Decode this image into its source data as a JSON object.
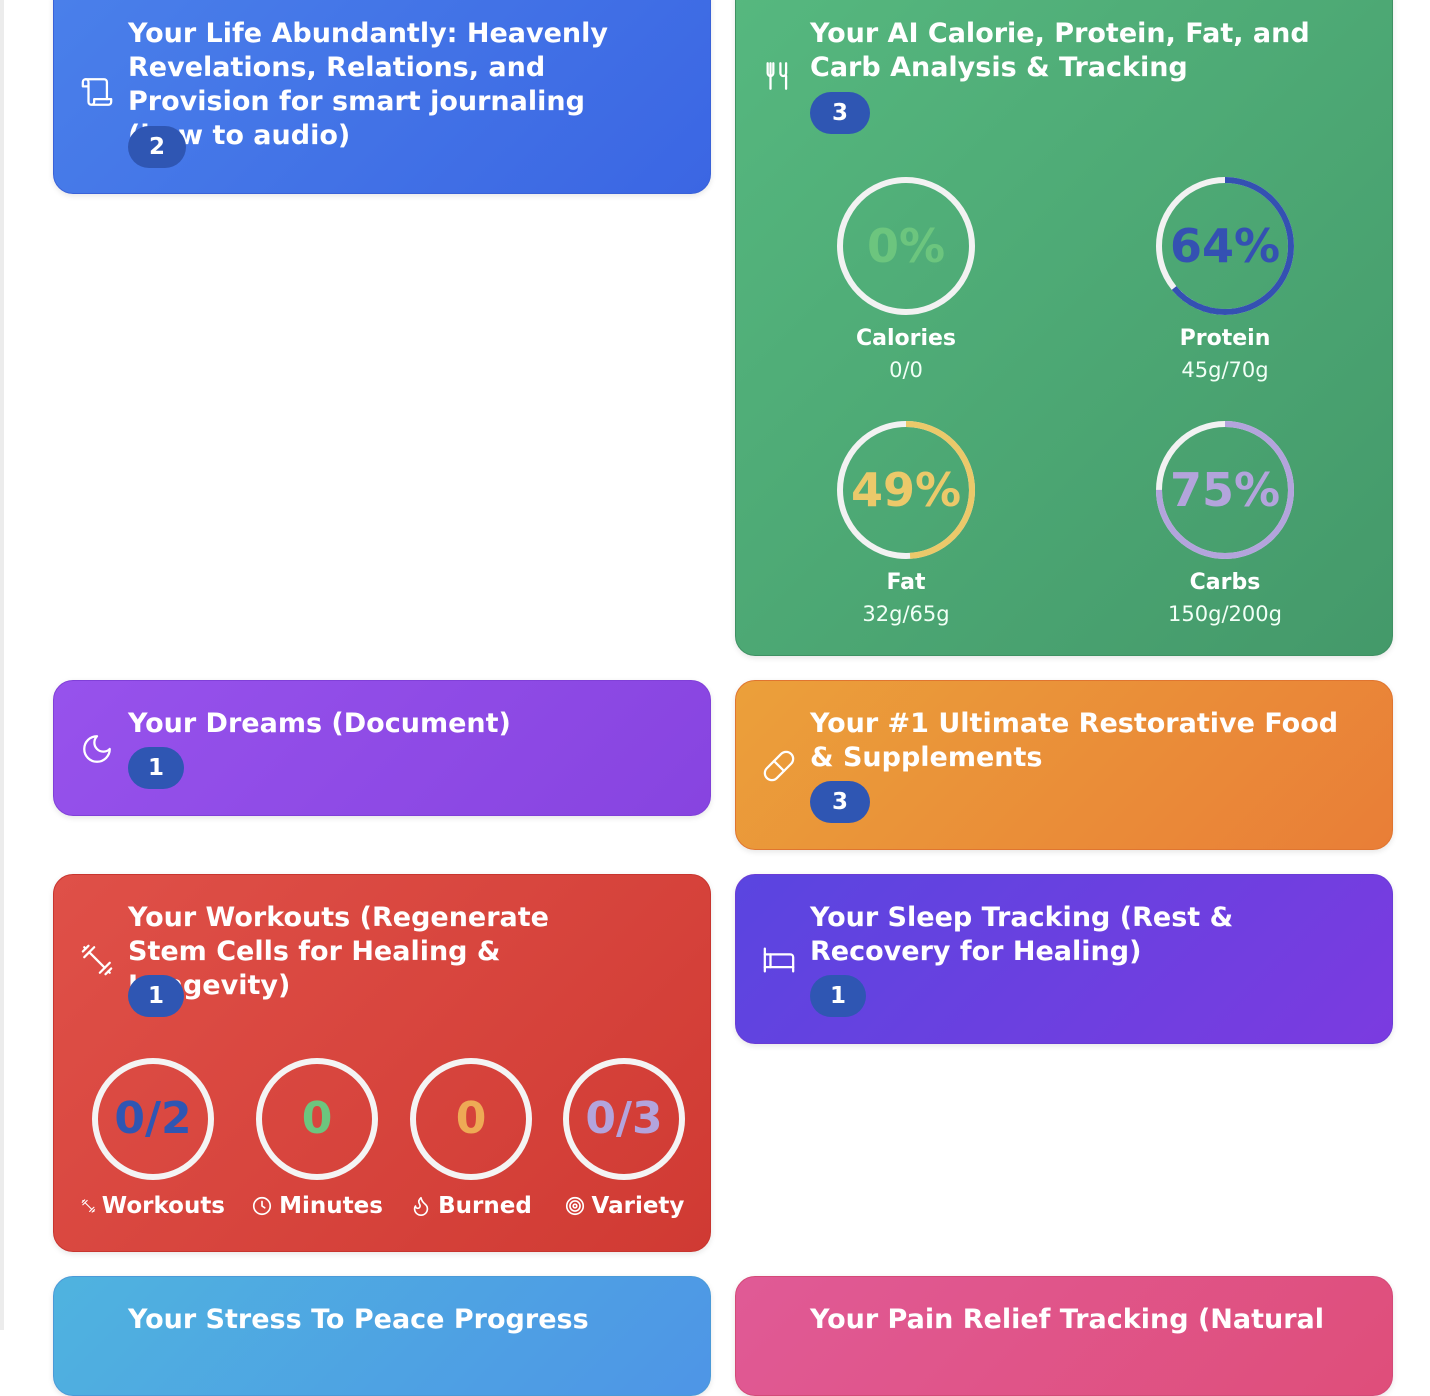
{
  "cards": {
    "journal": {
      "title": "Your Life Abundantly: Heavenly Revelations, Relations, and Provision for smart journaling (how to audio)",
      "badge": "2",
      "icon": "scroll-icon"
    },
    "nutrition": {
      "title": "Your AI Calorie, Protein, Fat, and Carb Analysis & Tracking",
      "badge": "3",
      "icon": "fork-knife-icon",
      "stats": [
        {
          "label": "Calories",
          "value": "0/0",
          "percent_text": "0%",
          "percent": 0,
          "color": "#6cc57e"
        },
        {
          "label": "Protein",
          "value": "45g/70g",
          "percent_text": "64%",
          "percent": 64,
          "color": "#3451b2"
        },
        {
          "label": "Fat",
          "value": "32g/65g",
          "percent_text": "49%",
          "percent": 49,
          "color": "#ebc96a"
        },
        {
          "label": "Carbs",
          "value": "150g/200g",
          "percent_text": "75%",
          "percent": 75,
          "color": "#b3a4dc"
        }
      ]
    },
    "dreams": {
      "title": "Your Dreams (Document)",
      "badge": "1",
      "icon": "moon-icon"
    },
    "supplements": {
      "title": "Your #1 Ultimate Restorative Food & Supplements",
      "badge": "3",
      "icon": "pill-icon"
    },
    "workouts": {
      "title": "Your Workouts (Regenerate Stem Cells for Healing & Longevity)",
      "badge": "1",
      "icon": "dumbbell-icon",
      "stats": [
        {
          "value": "0/2",
          "label": "Workouts",
          "icon": "dumbbell-icon",
          "color": "#2f56b3"
        },
        {
          "value": "0",
          "label": "Minutes",
          "icon": "clock-icon",
          "color": "#6cc57e"
        },
        {
          "value": "0",
          "label": "Burned",
          "icon": "flame-icon",
          "color": "#eeaa55"
        },
        {
          "value": "0/3",
          "label": "Variety",
          "icon": "target-icon",
          "color": "#b3a4dc"
        }
      ]
    },
    "sleep": {
      "title": "Your Sleep Tracking (Rest & Recovery for Healing)",
      "badge": "1",
      "icon": "bed-icon"
    },
    "stress": {
      "title": "Your Stress To Peace Progress"
    },
    "pain": {
      "title": "Your Pain Relief Tracking (Natural"
    }
  }
}
